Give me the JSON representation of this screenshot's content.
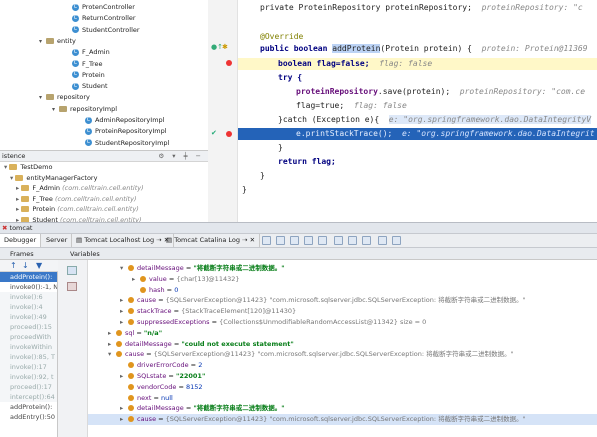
{
  "project_tree": [
    {
      "label": "ProtenController",
      "indent": 5,
      "kind": "class",
      "arrow": ""
    },
    {
      "label": "ReturnController",
      "indent": 5,
      "kind": "class",
      "arrow": ""
    },
    {
      "label": "StudentController",
      "indent": 5,
      "kind": "class",
      "arrow": ""
    },
    {
      "label": "entity",
      "indent": 3,
      "kind": "folder",
      "arrow": "▾"
    },
    {
      "label": "F_Admin",
      "indent": 5,
      "kind": "class",
      "arrow": ""
    },
    {
      "label": "F_Tree",
      "indent": 5,
      "kind": "class",
      "arrow": ""
    },
    {
      "label": "Protein",
      "indent": 5,
      "kind": "class",
      "arrow": ""
    },
    {
      "label": "Student",
      "indent": 5,
      "kind": "class",
      "arrow": ""
    },
    {
      "label": "repository",
      "indent": 3,
      "kind": "folder",
      "arrow": "▾"
    },
    {
      "label": "repositoryImpl",
      "indent": 4,
      "kind": "folder",
      "arrow": "▾"
    },
    {
      "label": "AdminRepositoryImpl",
      "indent": 6,
      "kind": "class",
      "arrow": ""
    },
    {
      "label": "ProteinRepositoryImpl",
      "indent": 6,
      "kind": "class",
      "arrow": ""
    },
    {
      "label": "StudentRepositoryImpl",
      "indent": 6,
      "kind": "class",
      "arrow": ""
    }
  ],
  "persistence": {
    "title": "istence",
    "rows": [
      {
        "label": "TestDemo",
        "extra": ""
      },
      {
        "label": "entityManagerFactory",
        "extra": ""
      },
      {
        "label": "F_Admin",
        "extra": "(com.celltrain.cell.entity)"
      },
      {
        "label": "F_Tree",
        "extra": "(com.celltrain.cell.entity)"
      },
      {
        "label": "Protein",
        "extra": "(com.celltrain.cell.entity)"
      },
      {
        "label": "Student",
        "extra": "(com.celltrain.cell.entity)"
      }
    ]
  },
  "editor": {
    "line0_code": "private ProteinRepository proteinRepository;",
    "line0_hint": "proteinRepository: \"c",
    "override": "@Override",
    "sig_mod": "public boolean ",
    "sig_method": "addProtein",
    "sig_rest": "(Protein protein) {",
    "sig_hint": "protein: Protein@11369",
    "flag_decl": "boolean flag=false;",
    "flag_hint": "flag: false",
    "try": "try {",
    "save_field": "proteinRepository",
    "save_rest": ".save(protein);",
    "save_hint": "proteinRepository: \"com.ce",
    "flag_true": "flag=true;",
    "flag_true_hint": "flag: false",
    "catch": "}catch (Exception e){",
    "catch_hint": "e: \"org.springframework.dao.DataIntegrityV",
    "print": "e.printStackTrace();",
    "print_hint": "e: \"org.springframework.dao.DataIntegrit",
    "close1": "}",
    "ret": "return flag;",
    "close2": "}",
    "close3": "}"
  },
  "run_tab": "tomcat",
  "tabs": [
    "Debugger",
    "Server",
    "Tomcat Localhost Log",
    "Tomcat Catalina Log"
  ],
  "frames_title": "Frames",
  "variables_title": "Variables",
  "frames": [
    {
      "label": "addProtein():",
      "style": "act"
    },
    {
      "label": "invoke0():-1, N",
      "style": ""
    },
    {
      "label": "invoke():6",
      "style": "lib"
    },
    {
      "label": "invoke():4",
      "style": "lib"
    },
    {
      "label": "invoke():49",
      "style": "lib"
    },
    {
      "label": "proceed():15",
      "style": "lib"
    },
    {
      "label": "proceedWith",
      "style": "lib"
    },
    {
      "label": "invokeWithin",
      "style": "lib"
    },
    {
      "label": "invoke():85, T",
      "style": "lib"
    },
    {
      "label": "invoke():17",
      "style": "lib"
    },
    {
      "label": "invoke():92, t",
      "style": "lib"
    },
    {
      "label": "proceed():17",
      "style": "lib"
    },
    {
      "label": "intercept():64",
      "style": "lib"
    },
    {
      "label": "addProtein():",
      "style": ""
    },
    {
      "label": "addEntry():50",
      "style": ""
    }
  ],
  "variables": [
    {
      "indent": 0,
      "arrow": "▾",
      "name": "detailMessage",
      "eq": " = ",
      "val": "\"将截断字符串或二进制数据。\"",
      "valcls": "str",
      "sel": false
    },
    {
      "indent": 1,
      "arrow": "▸",
      "name": "value",
      "eq": " = ",
      "val": "{char[13]@11432}",
      "valcls": "vg",
      "sel": false
    },
    {
      "indent": 1,
      "arrow": "",
      "name": "hash",
      "eq": " = ",
      "val": "0",
      "valcls": "num",
      "sel": false
    },
    {
      "indent": 0,
      "arrow": "▸",
      "name": "cause",
      "eq": " = ",
      "val": "{SQLServerException@11423} \"com.microsoft.sqlserver.jdbc.SQLServerException: 将截断字符串或二进制数据。\"",
      "valcls": "vg",
      "sel": false
    },
    {
      "indent": 0,
      "arrow": "▸",
      "name": "stackTrace",
      "eq": " = ",
      "val": "{StackTraceElement[120]@11430}",
      "valcls": "vg",
      "sel": false
    },
    {
      "indent": 0,
      "arrow": "▸",
      "name": "suppressedExceptions",
      "eq": " = ",
      "val": "{Collections$UnmodifiableRandomAccessList@11342}  size = 0",
      "valcls": "vg",
      "sel": false
    },
    {
      "indent": -1,
      "arrow": "▸",
      "name": "sql",
      "eq": " = ",
      "val": "\"n/a\"",
      "valcls": "str",
      "sel": false
    },
    {
      "indent": -1,
      "arrow": "▸",
      "name": "detailMessage",
      "eq": " = ",
      "val": "\"could not execute statement\"",
      "valcls": "str",
      "sel": false
    },
    {
      "indent": -1,
      "arrow": "▾",
      "name": "cause",
      "eq": " = ",
      "val": "{SQLServerException@11423} \"com.microsoft.sqlserver.jdbc.SQLServerException: 将截断字符串或二进制数据。\"",
      "valcls": "vg",
      "sel": false
    },
    {
      "indent": 0,
      "arrow": "",
      "name": "driverErrorCode",
      "eq": " = ",
      "val": "2",
      "valcls": "num",
      "sel": false
    },
    {
      "indent": 0,
      "arrow": "▸",
      "name": "SQLstate",
      "eq": " = ",
      "val": "\"22001\"",
      "valcls": "str",
      "sel": false
    },
    {
      "indent": 0,
      "arrow": "",
      "name": "vendorCode",
      "eq": " = ",
      "val": "8152",
      "valcls": "num",
      "sel": false
    },
    {
      "indent": 0,
      "arrow": "",
      "name": "next",
      "eq": " = ",
      "val": "null",
      "valcls": "num",
      "sel": false
    },
    {
      "indent": 0,
      "arrow": "▸",
      "name": "detailMessage",
      "eq": " = ",
      "val": "\"将截断字符串或二进制数据。\"",
      "valcls": "str",
      "sel": false
    },
    {
      "indent": 0,
      "arrow": "▸",
      "name": "cause",
      "eq": " = ",
      "val": "{SQLServerException@11423} \"com.microsoft.sqlserver.jdbc.SQLServerException: 将截断字符串或二进制数据。\"",
      "valcls": "vg",
      "sel": true
    }
  ]
}
